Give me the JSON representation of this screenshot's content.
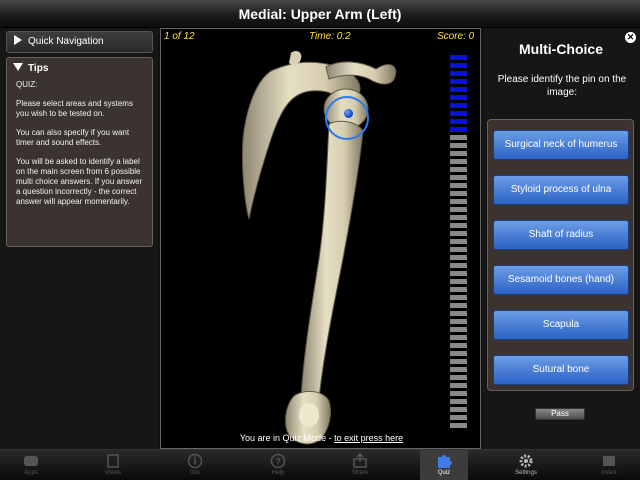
{
  "title": "Medial: Upper Arm (Left)",
  "left_panel": {
    "quick_nav_label": "Quick Navigation",
    "tips_title": "Tips",
    "tips_heading": "QUIZ:",
    "tips_paragraphs": [
      "Please select areas and systems you wish to be tested on.",
      "You can also specify if you want timer and sound effects.",
      "You will be asked to identify a label on the main screen from 6 possible multi choice answers. If you answer a question incorrectly - the correct answer will appear momentarily."
    ]
  },
  "quiz_view": {
    "progress": "1 of 12",
    "time": "Time: 0:2",
    "score": "Score: 0",
    "exit_text": "You are in Quiz Mode - ",
    "exit_link": "to exit press here",
    "progress_bars": {
      "filled": 10,
      "total": 47,
      "filled_color": "#0b10e0",
      "empty_color": "#8a8a8a"
    }
  },
  "right_panel": {
    "title": "Multi-Choice",
    "prompt": "Please identify the pin on the image:",
    "choices": [
      "Surgical neck of humerus",
      "Styloid process of ulna",
      "Shaft of radius",
      "Sesamoid bones (hand)",
      "Scapula",
      "Sutural bone"
    ],
    "pass_label": "Pass"
  },
  "tabs": [
    {
      "label": "Apps",
      "icon": "apps-icon"
    },
    {
      "label": "Views",
      "icon": "views-icon"
    },
    {
      "label": "Info",
      "icon": "info-icon"
    },
    {
      "label": "Help",
      "icon": "help-icon"
    },
    {
      "label": "Share",
      "icon": "share-icon"
    },
    {
      "label": "Quiz",
      "icon": "quiz-puzzle-icon",
      "active": true
    },
    {
      "label": "Settings",
      "icon": "settings-gear-icon"
    },
    {
      "label": "Index",
      "icon": "index-icon"
    }
  ],
  "colors": {
    "accent_blue": "#2b62c4",
    "score_yellow": "#ffe234",
    "panel_brown": "#3a3330"
  }
}
